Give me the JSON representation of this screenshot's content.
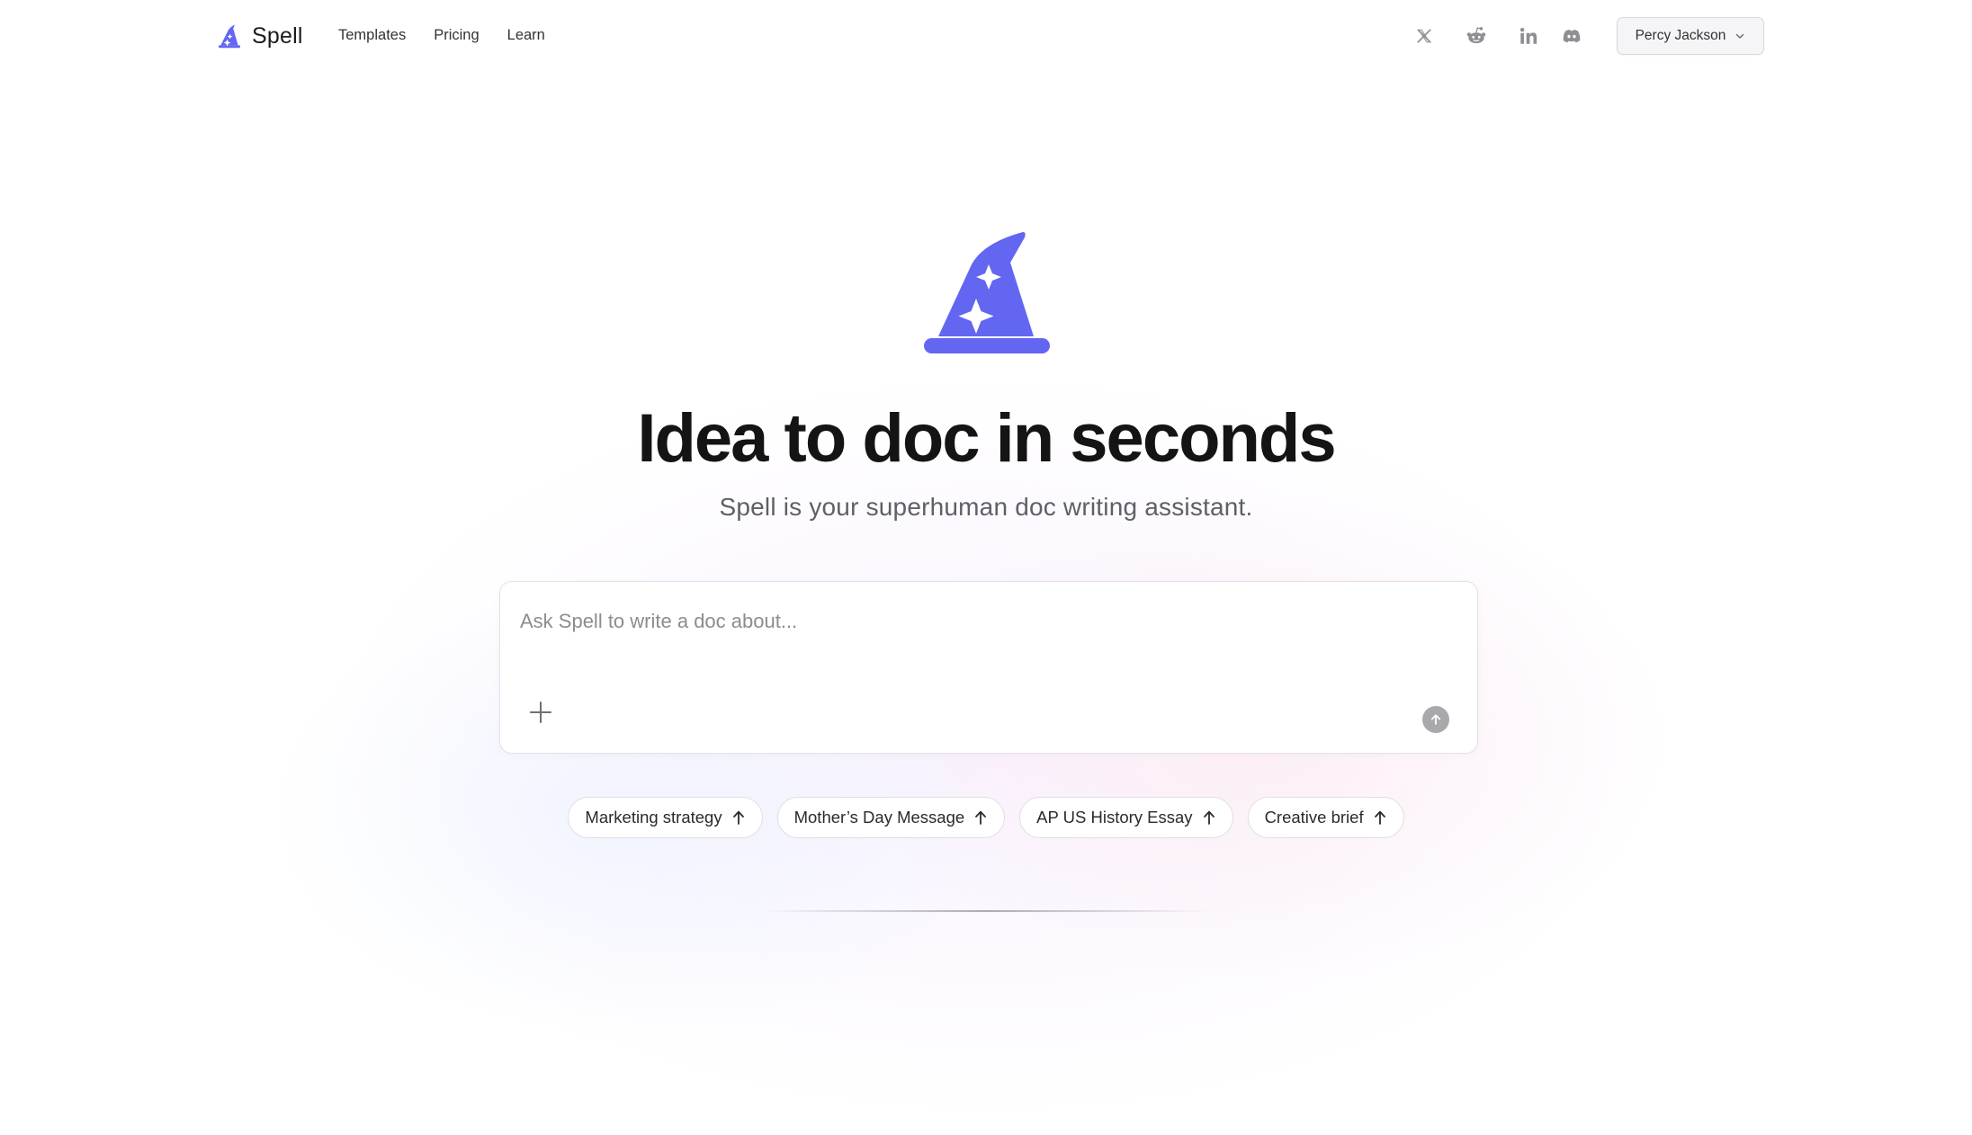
{
  "brand": {
    "name": "Spell",
    "accent": "#6366f1"
  },
  "nav": {
    "items": [
      {
        "label": "Templates"
      },
      {
        "label": "Pricing"
      },
      {
        "label": "Learn"
      }
    ]
  },
  "socials": {
    "items": [
      {
        "icon": "x-twitter-icon"
      },
      {
        "icon": "reddit-icon"
      },
      {
        "icon": "linkedin-icon"
      },
      {
        "icon": "discord-icon"
      }
    ]
  },
  "user": {
    "name": "Percy Jackson"
  },
  "hero": {
    "title": "Idea to doc in seconds",
    "subtitle": "Spell is your superhuman doc writing assistant."
  },
  "prompt": {
    "placeholder": "Ask Spell to write a doc about...",
    "value": ""
  },
  "suggestions": [
    {
      "label": "Marketing strategy"
    },
    {
      "label": "Mother’s Day Message"
    },
    {
      "label": "AP US History Essay"
    },
    {
      "label": "Creative brief"
    }
  ]
}
